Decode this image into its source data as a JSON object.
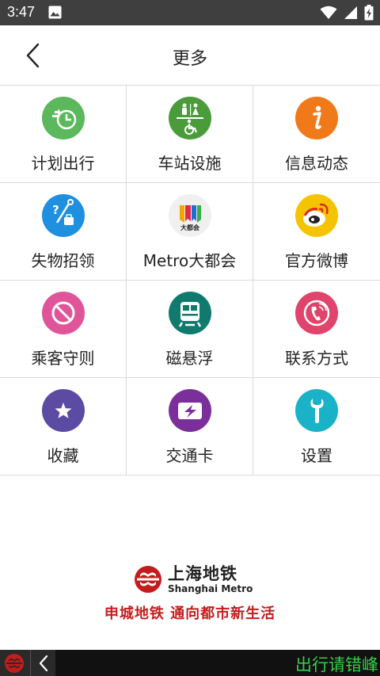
{
  "status_bar": {
    "time": "3:47",
    "icons": [
      "image-icon",
      "wifi-icon",
      "signal-icon",
      "battery-icon"
    ]
  },
  "header": {
    "title": "更多",
    "back_icon": "chevron-left-icon"
  },
  "grid": [
    {
      "label": "计划出行",
      "icon": "plan-trip-icon",
      "color": "#5cb85c"
    },
    {
      "label": "车站设施",
      "icon": "station-facilities-icon",
      "color": "#4a9b3a"
    },
    {
      "label": "信息动态",
      "icon": "info-icon",
      "color": "#f07a1a"
    },
    {
      "label": "失物招领",
      "icon": "lost-found-icon",
      "color": "#1f8fe0"
    },
    {
      "label": "Metro大都会",
      "icon": "metro-app-icon",
      "color": "#f0f0f0"
    },
    {
      "label": "官方微博",
      "icon": "weibo-icon",
      "color": "#f5c400"
    },
    {
      "label": "乘客守则",
      "icon": "prohibited-icon",
      "color": "#e0559a"
    },
    {
      "label": "磁悬浮",
      "icon": "maglev-train-icon",
      "color": "#107a6e"
    },
    {
      "label": "联系方式",
      "icon": "phone-icon",
      "color": "#e0436b"
    },
    {
      "label": "收藏",
      "icon": "star-icon",
      "color": "#5b4ba3"
    },
    {
      "label": "交通卡",
      "icon": "transport-card-icon",
      "color": "#7b2f9a"
    },
    {
      "label": "设置",
      "icon": "wrench-icon",
      "color": "#1ab2c7"
    }
  ],
  "metro_app_badge": "大都会",
  "brand": {
    "name_cn": "上海地铁",
    "name_en": "Shanghai Metro",
    "slogan": "申城地铁 通向都市新生活",
    "color": "#c41c1c"
  },
  "bottom_bar": {
    "marquee_text": "出行请错峰"
  }
}
